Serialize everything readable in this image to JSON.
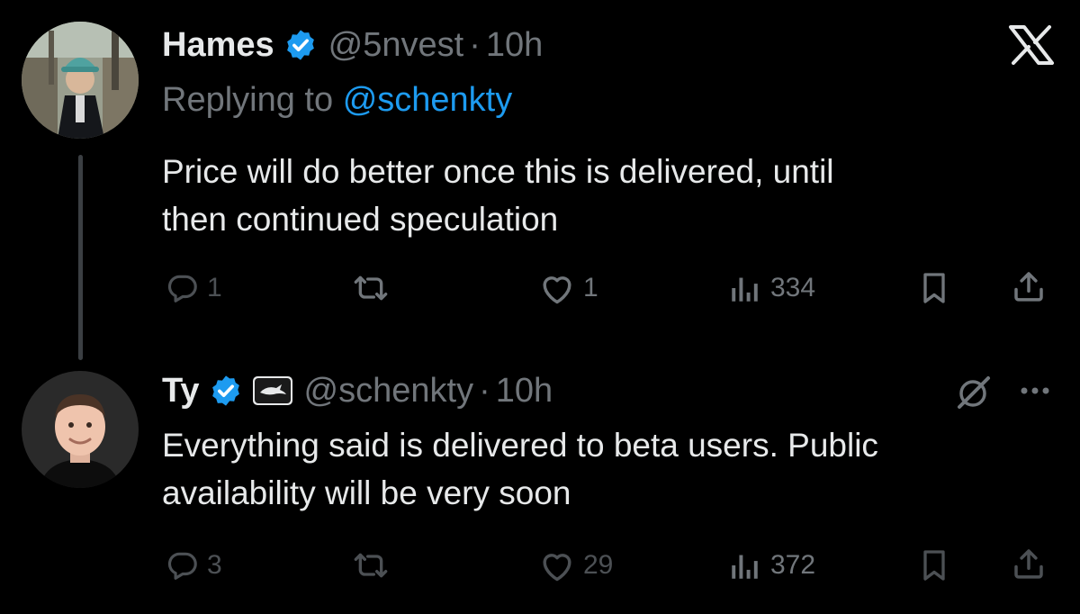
{
  "close_label": "X",
  "tweets": [
    {
      "author": "Hames",
      "handle": "@5nvest",
      "separator": "·",
      "time": "10h",
      "replying_prefix": "Replying to",
      "replying_to": "@schenkty",
      "text_lines": [
        "Price will do better once this is delivered, until",
        "then continued speculation"
      ],
      "stats": {
        "replies": "1",
        "likes": "1",
        "views": "334"
      }
    },
    {
      "author": "Ty",
      "handle": "@schenkty",
      "separator": "·",
      "time": "10h",
      "text_lines": [
        "Everything said is delivered to beta users. Public",
        "availability will be very soon"
      ],
      "stats": {
        "replies": "3",
        "likes": "29",
        "views": "372"
      }
    }
  ],
  "icons": {
    "verified": "verified-badge-icon",
    "reply": "reply-icon",
    "retweet": "retweet-icon",
    "like": "like-icon",
    "views": "views-icon",
    "bookmark": "bookmark-icon",
    "share": "share-icon",
    "affiliate": "affiliate-logo-icon",
    "grok": "grok-icon",
    "more": "more-icon",
    "close": "x-logo-icon"
  },
  "colors": {
    "background": "#000000",
    "text": "#e7e9ea",
    "muted": "#71767b",
    "accent": "#1d9bf0"
  }
}
